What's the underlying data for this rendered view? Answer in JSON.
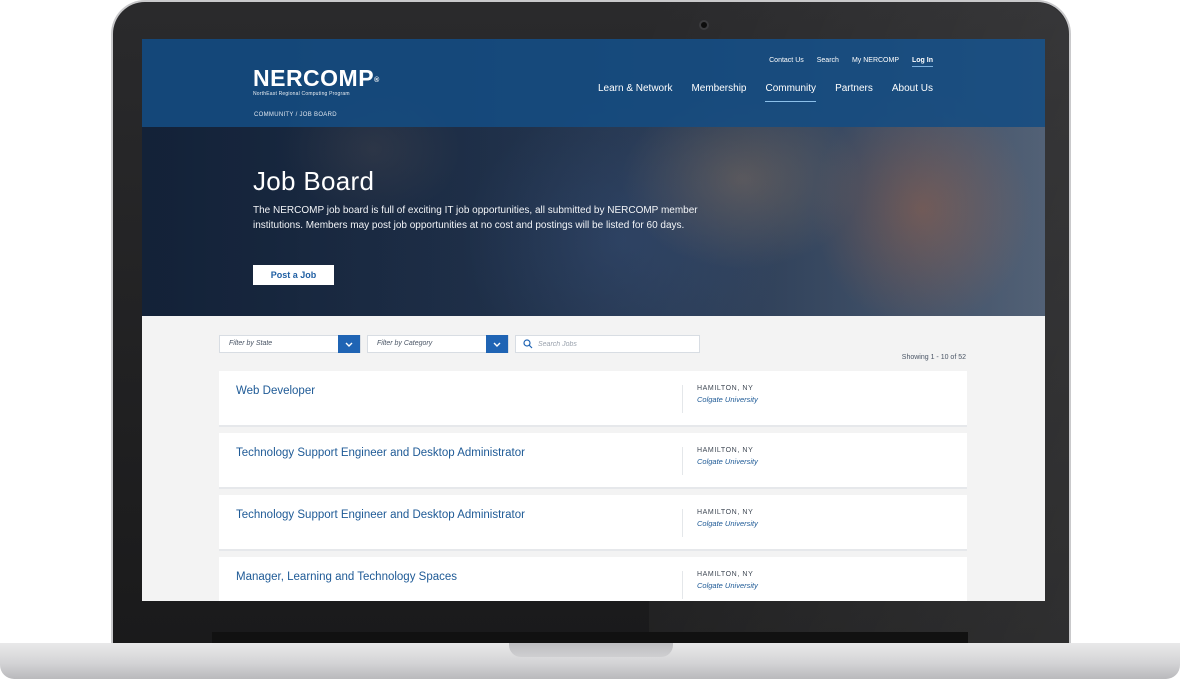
{
  "site": {
    "logo_text": "NERCOMP",
    "logo_mark": "®",
    "tagline": "NorthEast Regional Computing Program"
  },
  "utility_nav": [
    "Contact Us",
    "Search",
    "My NERCOMP",
    "Log In"
  ],
  "main_nav": [
    "Learn & Network",
    "Membership",
    "Community",
    "Partners",
    "About Us"
  ],
  "main_nav_active": "Community",
  "breadcrumb": {
    "parent": "COMMUNITY",
    "separator": "/",
    "current": "JOB BOARD"
  },
  "hero": {
    "title": "Job Board",
    "description": "The NERCOMP job board is full of exciting IT job opportunities, all submitted by NERCOMP member institutions. Members may post job opportunities at no cost and postings will be listed for 60 days.",
    "cta_label": "Post a Job"
  },
  "filters": {
    "state_placeholder": "Filter by State",
    "category_placeholder": "Filter by Category",
    "search_placeholder": "Search Jobs"
  },
  "results_summary": "Showing 1 - 10 of 52",
  "jobs": [
    {
      "title": "Web Developer",
      "location": "HAMILTON, NY",
      "organization": "Colgate University"
    },
    {
      "title": "Technology Support Engineer and Desktop Administrator",
      "location": "HAMILTON, NY",
      "organization": "Colgate University"
    },
    {
      "title": "Technology Support Engineer and Desktop Administrator",
      "location": "HAMILTON, NY",
      "organization": "Colgate University"
    },
    {
      "title": "Manager, Learning and Technology Spaces",
      "location": "HAMILTON, NY",
      "organization": "Colgate University"
    }
  ],
  "colors": {
    "brand_blue": "#1f64b4",
    "header_blue": "#144c82",
    "link_blue": "#1e5a96",
    "page_background": "#f3f3f3"
  },
  "icons": [
    "search-icon",
    "chevron-down-icon",
    "camera-icon"
  ]
}
